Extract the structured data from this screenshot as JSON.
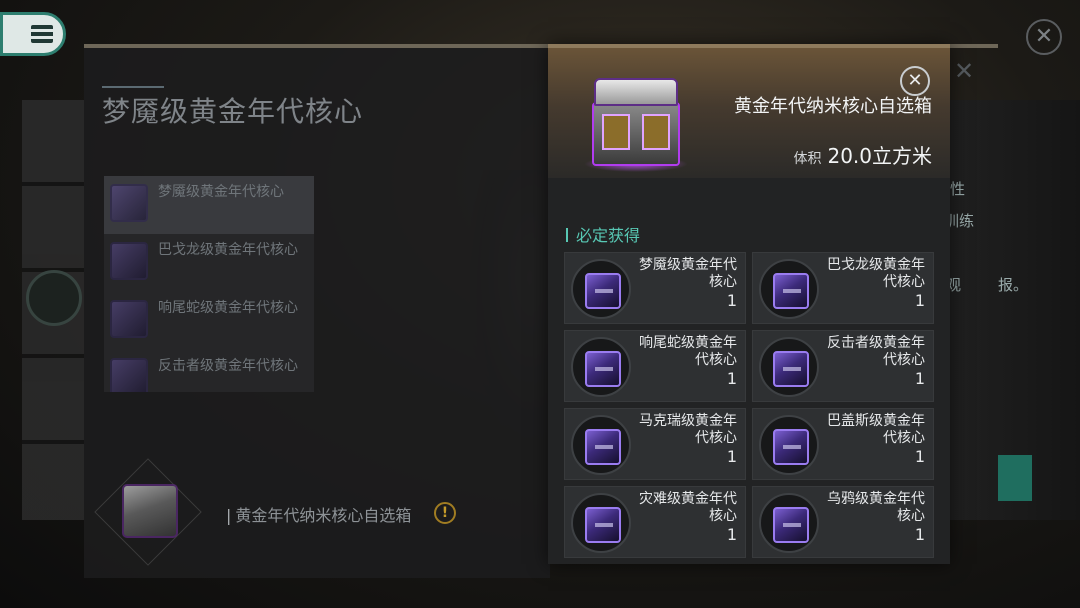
{
  "background": {
    "panel_title": "梦魇级黄金年代核心",
    "list_items": [
      {
        "label": "梦魇级黄金年代核心",
        "selected": true
      },
      {
        "label": "巴戈龙级黄金年代核心",
        "selected": false
      },
      {
        "label": "响尾蛇级黄金年代核心",
        "selected": false
      },
      {
        "label": "反击者级黄金年代核心",
        "selected": false
      }
    ],
    "bottom_item_label": "黄金年代纳米核心自选箱",
    "bottom_item_marker": "|",
    "warn_glyph": "!",
    "right_tags": [
      "性",
      "训练",
      "观",
      "报。"
    ]
  },
  "popup": {
    "item_name": "黄金年代纳米核心自选箱",
    "volume_label": "体积",
    "volume_value": "20.0立方米",
    "section_title": "必定获得",
    "rewards": [
      {
        "name": "梦魇级黄金年代核心",
        "qty": "1"
      },
      {
        "name": "巴戈龙级黄金年代核心",
        "qty": "1"
      },
      {
        "name": "响尾蛇级黄金年代核心",
        "qty": "1"
      },
      {
        "name": "反击者级黄金年代核心",
        "qty": "1"
      },
      {
        "name": "马克瑞级黄金年代核心",
        "qty": "1"
      },
      {
        "name": "巴盖斯级黄金年代核心",
        "qty": "1"
      },
      {
        "name": "灾难级黄金年代核心",
        "qty": "1"
      },
      {
        "name": "乌鸦级黄金年代核心",
        "qty": "1"
      }
    ]
  },
  "icons": {
    "menu": "menu-icon",
    "close": "close-icon",
    "warning": "warning-icon",
    "crate": "crate-icon",
    "core": "core-module-icon"
  },
  "colors": {
    "accent_teal": "#58c8b4",
    "menu_border": "#2d7e6f",
    "rarity_purple": "#9a7cf0",
    "warning_gold": "#c49a2a"
  }
}
